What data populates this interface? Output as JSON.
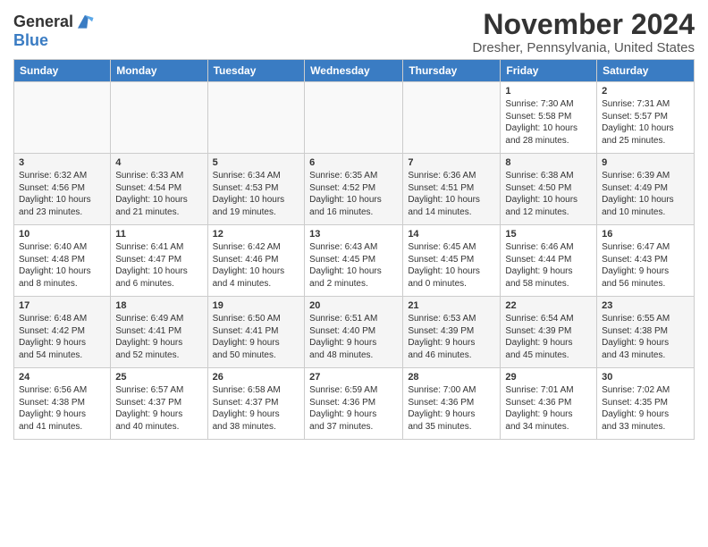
{
  "header": {
    "logo_line1": "General",
    "logo_line2": "Blue",
    "month": "November 2024",
    "location": "Dresher, Pennsylvania, United States"
  },
  "weekdays": [
    "Sunday",
    "Monday",
    "Tuesday",
    "Wednesday",
    "Thursday",
    "Friday",
    "Saturday"
  ],
  "weeks": [
    [
      {
        "day": "",
        "info": ""
      },
      {
        "day": "",
        "info": ""
      },
      {
        "day": "",
        "info": ""
      },
      {
        "day": "",
        "info": ""
      },
      {
        "day": "",
        "info": ""
      },
      {
        "day": "1",
        "info": "Sunrise: 7:30 AM\nSunset: 5:58 PM\nDaylight: 10 hours\nand 28 minutes."
      },
      {
        "day": "2",
        "info": "Sunrise: 7:31 AM\nSunset: 5:57 PM\nDaylight: 10 hours\nand 25 minutes."
      }
    ],
    [
      {
        "day": "3",
        "info": "Sunrise: 6:32 AM\nSunset: 4:56 PM\nDaylight: 10 hours\nand 23 minutes."
      },
      {
        "day": "4",
        "info": "Sunrise: 6:33 AM\nSunset: 4:54 PM\nDaylight: 10 hours\nand 21 minutes."
      },
      {
        "day": "5",
        "info": "Sunrise: 6:34 AM\nSunset: 4:53 PM\nDaylight: 10 hours\nand 19 minutes."
      },
      {
        "day": "6",
        "info": "Sunrise: 6:35 AM\nSunset: 4:52 PM\nDaylight: 10 hours\nand 16 minutes."
      },
      {
        "day": "7",
        "info": "Sunrise: 6:36 AM\nSunset: 4:51 PM\nDaylight: 10 hours\nand 14 minutes."
      },
      {
        "day": "8",
        "info": "Sunrise: 6:38 AM\nSunset: 4:50 PM\nDaylight: 10 hours\nand 12 minutes."
      },
      {
        "day": "9",
        "info": "Sunrise: 6:39 AM\nSunset: 4:49 PM\nDaylight: 10 hours\nand 10 minutes."
      }
    ],
    [
      {
        "day": "10",
        "info": "Sunrise: 6:40 AM\nSunset: 4:48 PM\nDaylight: 10 hours\nand 8 minutes."
      },
      {
        "day": "11",
        "info": "Sunrise: 6:41 AM\nSunset: 4:47 PM\nDaylight: 10 hours\nand 6 minutes."
      },
      {
        "day": "12",
        "info": "Sunrise: 6:42 AM\nSunset: 4:46 PM\nDaylight: 10 hours\nand 4 minutes."
      },
      {
        "day": "13",
        "info": "Sunrise: 6:43 AM\nSunset: 4:45 PM\nDaylight: 10 hours\nand 2 minutes."
      },
      {
        "day": "14",
        "info": "Sunrise: 6:45 AM\nSunset: 4:45 PM\nDaylight: 10 hours\nand 0 minutes."
      },
      {
        "day": "15",
        "info": "Sunrise: 6:46 AM\nSunset: 4:44 PM\nDaylight: 9 hours\nand 58 minutes."
      },
      {
        "day": "16",
        "info": "Sunrise: 6:47 AM\nSunset: 4:43 PM\nDaylight: 9 hours\nand 56 minutes."
      }
    ],
    [
      {
        "day": "17",
        "info": "Sunrise: 6:48 AM\nSunset: 4:42 PM\nDaylight: 9 hours\nand 54 minutes."
      },
      {
        "day": "18",
        "info": "Sunrise: 6:49 AM\nSunset: 4:41 PM\nDaylight: 9 hours\nand 52 minutes."
      },
      {
        "day": "19",
        "info": "Sunrise: 6:50 AM\nSunset: 4:41 PM\nDaylight: 9 hours\nand 50 minutes."
      },
      {
        "day": "20",
        "info": "Sunrise: 6:51 AM\nSunset: 4:40 PM\nDaylight: 9 hours\nand 48 minutes."
      },
      {
        "day": "21",
        "info": "Sunrise: 6:53 AM\nSunset: 4:39 PM\nDaylight: 9 hours\nand 46 minutes."
      },
      {
        "day": "22",
        "info": "Sunrise: 6:54 AM\nSunset: 4:39 PM\nDaylight: 9 hours\nand 45 minutes."
      },
      {
        "day": "23",
        "info": "Sunrise: 6:55 AM\nSunset: 4:38 PM\nDaylight: 9 hours\nand 43 minutes."
      }
    ],
    [
      {
        "day": "24",
        "info": "Sunrise: 6:56 AM\nSunset: 4:38 PM\nDaylight: 9 hours\nand 41 minutes."
      },
      {
        "day": "25",
        "info": "Sunrise: 6:57 AM\nSunset: 4:37 PM\nDaylight: 9 hours\nand 40 minutes."
      },
      {
        "day": "26",
        "info": "Sunrise: 6:58 AM\nSunset: 4:37 PM\nDaylight: 9 hours\nand 38 minutes."
      },
      {
        "day": "27",
        "info": "Sunrise: 6:59 AM\nSunset: 4:36 PM\nDaylight: 9 hours\nand 37 minutes."
      },
      {
        "day": "28",
        "info": "Sunrise: 7:00 AM\nSunset: 4:36 PM\nDaylight: 9 hours\nand 35 minutes."
      },
      {
        "day": "29",
        "info": "Sunrise: 7:01 AM\nSunset: 4:36 PM\nDaylight: 9 hours\nand 34 minutes."
      },
      {
        "day": "30",
        "info": "Sunrise: 7:02 AM\nSunset: 4:35 PM\nDaylight: 9 hours\nand 33 minutes."
      }
    ]
  ]
}
